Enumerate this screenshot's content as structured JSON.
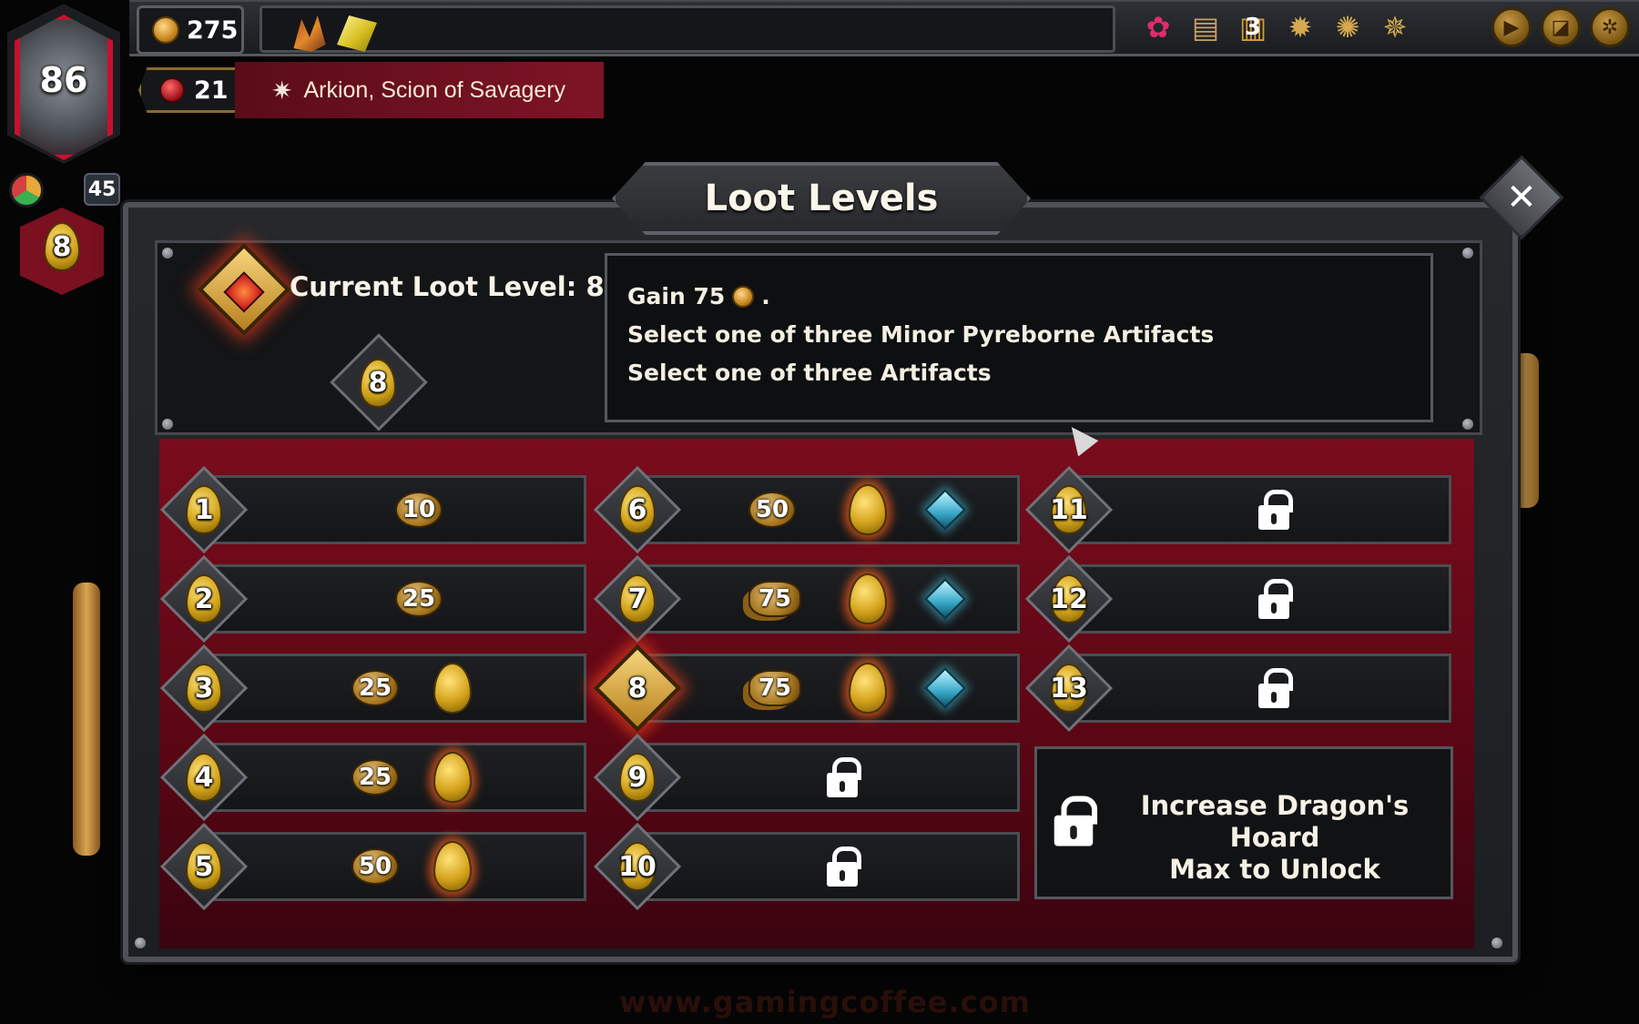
{
  "hud": {
    "gold": "275",
    "relics": [
      "claw-relic",
      "crystal-relic"
    ],
    "icons": [
      "bloom-icon",
      "codex-book-icon",
      "gate-icon",
      "sun-crest-icon",
      "medal-crest-icon",
      "blade-crest-icon"
    ],
    "gate_count": "3",
    "buttons": [
      "play-icon",
      "map-icon",
      "gear-icon"
    ]
  },
  "player": {
    "level": "86",
    "sub_value": "45",
    "hoard_level": "8",
    "health": "21",
    "boss_name": "Arkion, Scion of Savagery"
  },
  "modal": {
    "title": "Loot Levels",
    "close_label": "✕",
    "current_label": "Current Loot Level: 8",
    "current_badge": "8",
    "rewards": {
      "line1_prefix": "Gain 75",
      "line1_suffix": ".",
      "line2": "Select one of three Minor Pyreborne Artifacts",
      "line3": "Select one of three Artifacts"
    },
    "levels": [
      {
        "n": "1",
        "gold": "10",
        "egg": false,
        "glow": false,
        "cube": false,
        "locked": false
      },
      {
        "n": "2",
        "gold": "25",
        "egg": false,
        "glow": false,
        "cube": false,
        "locked": false
      },
      {
        "n": "3",
        "gold": "25",
        "egg": true,
        "glow": false,
        "cube": false,
        "locked": false
      },
      {
        "n": "4",
        "gold": "25",
        "egg": true,
        "glow": true,
        "cube": false,
        "locked": false
      },
      {
        "n": "5",
        "gold": "50",
        "egg": true,
        "glow": true,
        "cube": false,
        "locked": false
      },
      {
        "n": "6",
        "gold": "50",
        "egg": true,
        "glow": true,
        "cube": true,
        "locked": false
      },
      {
        "n": "7",
        "gold": "75",
        "egg": true,
        "glow": true,
        "cube": true,
        "locked": false
      },
      {
        "n": "8",
        "gold": "75",
        "egg": true,
        "glow": true,
        "cube": true,
        "locked": false,
        "current": true
      },
      {
        "n": "9",
        "locked": true
      },
      {
        "n": "10",
        "locked": true
      },
      {
        "n": "11",
        "locked": true
      },
      {
        "n": "12",
        "locked": true
      },
      {
        "n": "13",
        "locked": true
      }
    ],
    "unlock_line1": "Increase Dragon's Hoard",
    "unlock_line2": "Max to Unlock"
  },
  "watermark": "www.gamingcoffee.com",
  "colors": {
    "accent_red": "#7e1426",
    "gold": "#d0a21a",
    "frame": "#4e5156"
  }
}
